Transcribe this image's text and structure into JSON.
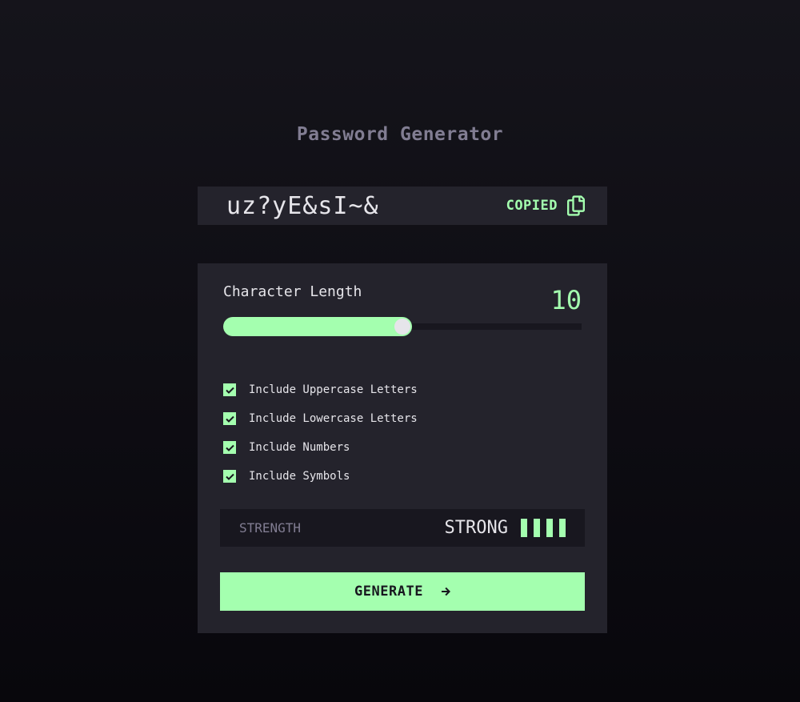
{
  "app": {
    "title": "Password Generator"
  },
  "password": {
    "value": "uz?yE&sI~&",
    "copied_label": "COPIED",
    "copy_icon": "copy-icon"
  },
  "length": {
    "label": "Character Length",
    "value": "10",
    "slider_fraction": 0.5
  },
  "options": [
    {
      "label": "Include Uppercase Letters",
      "checked": true
    },
    {
      "label": "Include Lowercase Letters",
      "checked": true
    },
    {
      "label": "Include Numbers",
      "checked": true
    },
    {
      "label": "Include Symbols",
      "checked": true
    }
  ],
  "strength": {
    "label": "STRENGTH",
    "value": "STRONG",
    "level": 4,
    "max_level": 4
  },
  "generate": {
    "label": "GENERATE",
    "icon": "arrow-right-icon"
  },
  "colors": {
    "accent": "#a4ffaf",
    "panel": "#24232c",
    "dark": "#18171f",
    "muted": "#817d92",
    "text": "#e6e5ea"
  }
}
